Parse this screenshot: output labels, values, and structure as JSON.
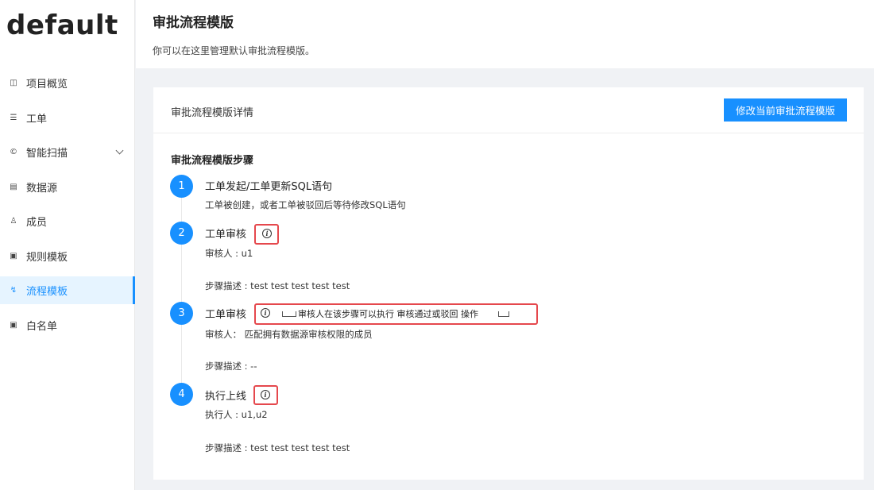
{
  "app": {
    "project_name": "default"
  },
  "sidebar": {
    "items": [
      {
        "label": "项目概览",
        "icon": "project-icon",
        "glyph": "◫"
      },
      {
        "label": "工单",
        "icon": "list-icon",
        "glyph": "☰"
      },
      {
        "label": "智能扫描",
        "icon": "scan-icon",
        "glyph": "©"
      },
      {
        "label": "数据源",
        "icon": "database-icon",
        "glyph": "▤"
      },
      {
        "label": "成员",
        "icon": "user-icon",
        "glyph": "♙"
      },
      {
        "label": "规则模板",
        "icon": "rule-icon",
        "glyph": "▣"
      },
      {
        "label": "流程模板",
        "icon": "workflow-icon",
        "glyph": "↯"
      },
      {
        "label": "白名单",
        "icon": "whitelist-icon",
        "glyph": "▣"
      }
    ],
    "active_index": 6
  },
  "header": {
    "title": "审批流程模版",
    "description": "你可以在这里管理默认审批流程模版。"
  },
  "card": {
    "title": "审批流程模版详情",
    "edit_button": "修改当前审批流程模版"
  },
  "steps": {
    "title": "审批流程模版步骤",
    "items": [
      {
        "num": "1",
        "title": "工单发起/工单更新SQL语句",
        "desc": "工单被创建，或者工单被驳回后等待修改SQL语句"
      },
      {
        "num": "2",
        "title": "工单审核",
        "person": "审核人 : u1",
        "desc": "步骤描述 : test test test test test"
      },
      {
        "num": "3",
        "title": "工单审核",
        "tooltip": "审核人在该步骤可以执行 审核通过或驳回 操作",
        "person": "审核人：  匹配拥有数据源审核权限的成员",
        "desc": "步骤描述 : --"
      },
      {
        "num": "4",
        "title": "执行上线",
        "person": "执行人 : u1,u2",
        "desc": "步骤描述 : test test test test test"
      }
    ]
  },
  "colors": {
    "primary": "#1890ff",
    "highlight": "#e5484d"
  }
}
